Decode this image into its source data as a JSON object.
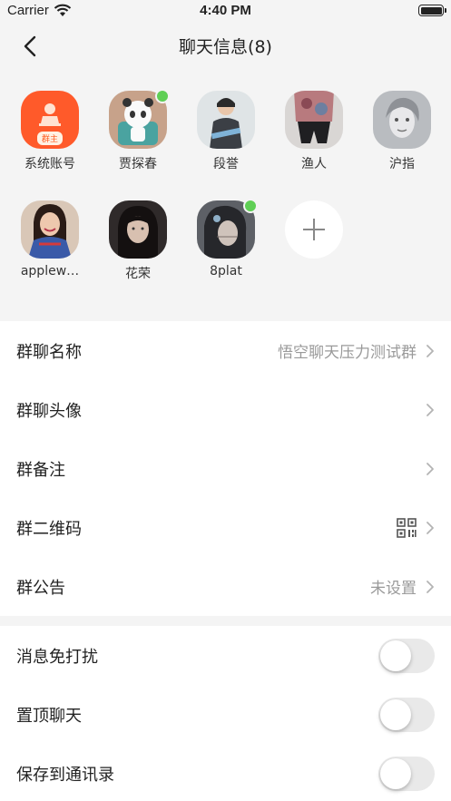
{
  "status_bar": {
    "carrier": "Carrier",
    "time": "4:40 PM"
  },
  "nav": {
    "title": "聊天信息(8)"
  },
  "members": [
    {
      "name": "系统账号",
      "tag": "群主",
      "online": false,
      "avatar": "system-account-avatar"
    },
    {
      "name": "贾探春",
      "online": true,
      "avatar": "panda-cartoon-avatar"
    },
    {
      "name": "段誉",
      "online": false,
      "avatar": "person-photo-avatar"
    },
    {
      "name": "渔人",
      "online": false,
      "avatar": "person-photo-avatar"
    },
    {
      "name": "沪指",
      "online": false,
      "avatar": "person-sketch-avatar"
    },
    {
      "name": "applew…",
      "online": false,
      "avatar": "person-photo-avatar"
    },
    {
      "name": "花荣",
      "online": false,
      "avatar": "person-photo-avatar"
    },
    {
      "name": "8plat",
      "online": true,
      "avatar": "person-photo-avatar"
    }
  ],
  "settings": {
    "group_name": {
      "label": "群聊名称",
      "value": "悟空聊天压力测试群"
    },
    "group_avatar": {
      "label": "群聊头像"
    },
    "group_remark": {
      "label": "群备注"
    },
    "group_qrcode": {
      "label": "群二维码",
      "icon": "qr-code-icon"
    },
    "group_notice": {
      "label": "群公告",
      "value": "未设置"
    }
  },
  "toggles": {
    "mute": {
      "label": "消息免打扰",
      "on": false
    },
    "pin": {
      "label": "置顶聊天",
      "on": false
    },
    "save_contacts": {
      "label": "保存到通讯录",
      "on": false
    }
  },
  "colors": {
    "accent": "#ff5a1e",
    "online": "#5fcf55",
    "background": "#f4f4f4"
  }
}
